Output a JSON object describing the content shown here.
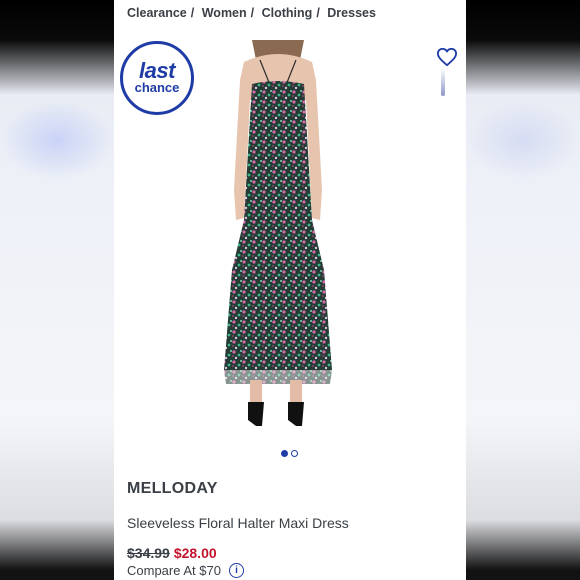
{
  "breadcrumb": {
    "items": [
      "Clearance",
      "Women",
      "Clothing",
      "Dresses"
    ]
  },
  "badge": {
    "line1": "last",
    "line2": "chance"
  },
  "carousel": {
    "slide_count": 2,
    "active_index": 0
  },
  "product": {
    "brand": "MELLODAY",
    "name": "Sleeveless Floral Halter Maxi Dress",
    "original_price": "$34.99",
    "sale_price": "$28.00",
    "compare_label": "Compare At $70",
    "info_icon": "i"
  },
  "icons": {
    "favorite": "heart-outline-icon",
    "info": "info-circle-icon"
  },
  "colors": {
    "accent": "#1f3ca6",
    "sale": "#c3142d",
    "text": "#3a4046"
  }
}
